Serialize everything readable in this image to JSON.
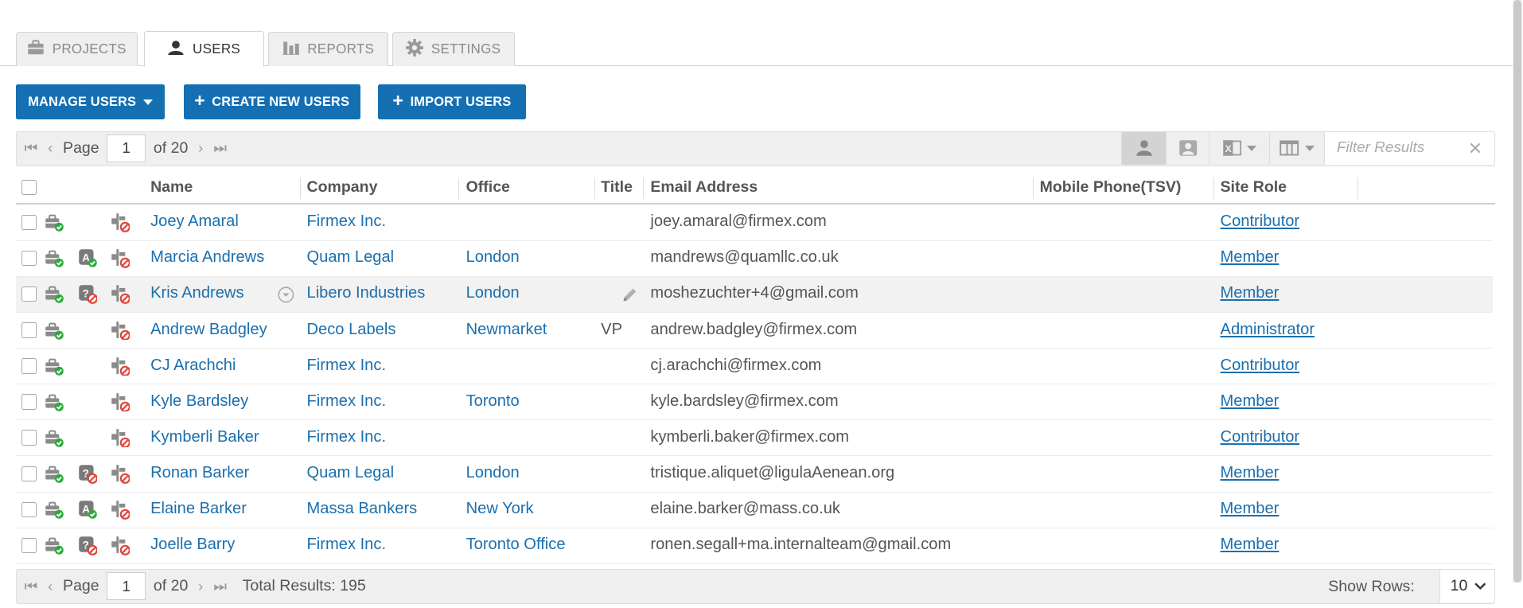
{
  "tabs": [
    {
      "label": "PROJECTS",
      "icon": "briefcase-icon"
    },
    {
      "label": "USERS",
      "icon": "user-icon",
      "active": true
    },
    {
      "label": "REPORTS",
      "icon": "bar-chart-icon"
    },
    {
      "label": "SETTINGS",
      "icon": "gear-icon"
    }
  ],
  "actions": {
    "manage_users": "MANAGE USERS",
    "create_new_users": "CREATE NEW USERS",
    "import_users": "IMPORT USERS"
  },
  "pager": {
    "page_label": "Page",
    "page_value": "1",
    "of_label": "of 20",
    "total_results": "Total Results: 195",
    "show_rows_label": "Show Rows:",
    "show_rows_value": "10"
  },
  "filter": {
    "placeholder": "Filter Results"
  },
  "columns": {
    "name": "Name",
    "company": "Company",
    "office": "Office",
    "title": "Title",
    "email": "Email Address",
    "mobile": "Mobile Phone(TSV)",
    "role": "Site Role"
  },
  "rows": [
    {
      "name": "Joey Amaral",
      "company": "Firmex Inc.",
      "office": "",
      "title": "",
      "email": "joey.amaral@firmex.com",
      "mobile": "",
      "role": "Contributor",
      "status_icon": ""
    },
    {
      "name": "Marcia Andrews",
      "company": "Quam Legal",
      "office": "London",
      "title": "",
      "email": "mandrews@quamllc.co.uk",
      "mobile": "",
      "role": "Member",
      "status_icon": "auth-approved-icon"
    },
    {
      "name": "Kris Andrews",
      "company": "Libero Industries",
      "office": "London",
      "title": "",
      "email": "moshezuchter+4@gmail.com",
      "mobile": "",
      "role": "Member",
      "status_icon": "auth-blocked-icon"
    },
    {
      "name": "Andrew Badgley",
      "company": "Deco Labels",
      "office": "Newmarket",
      "title": "VP",
      "email": "andrew.badgley@firmex.com",
      "mobile": "",
      "role": "Administrator",
      "status_icon": ""
    },
    {
      "name": "CJ Arachchi",
      "company": "Firmex Inc.",
      "office": "",
      "title": "",
      "email": "cj.arachchi@firmex.com",
      "mobile": "",
      "role": "Contributor",
      "status_icon": ""
    },
    {
      "name": "Kyle Bardsley",
      "company": "Firmex Inc.",
      "office": "Toronto",
      "title": "",
      "email": "kyle.bardsley@firmex.com",
      "mobile": "",
      "role": "Member",
      "status_icon": ""
    },
    {
      "name": "Kymberli Baker",
      "company": "Firmex Inc.",
      "office": "",
      "title": "",
      "email": "kymberli.baker@firmex.com",
      "mobile": "",
      "role": "Contributor",
      "status_icon": ""
    },
    {
      "name": "Ronan Barker",
      "company": "Quam Legal",
      "office": "London",
      "title": "",
      "email": "tristique.aliquet@ligulaAenean.org",
      "mobile": "",
      "role": "Member",
      "status_icon": "auth-blocked-icon"
    },
    {
      "name": "Elaine Barker",
      "company": "Massa Bankers",
      "office": "New York",
      "title": "",
      "email": "elaine.barker@mass.co.uk",
      "mobile": "",
      "role": "Member",
      "status_icon": "auth-approved-icon"
    },
    {
      "name": "Joelle Barry",
      "company": "Firmex Inc.",
      "office": "Toronto Office",
      "title": "",
      "email": "ronen.segall+ma.internalteam@gmail.com",
      "mobile": "",
      "role": "Member",
      "status_icon": "auth-blocked-icon"
    }
  ],
  "colors": {
    "accent": "#1470b3",
    "link": "#1a6fae",
    "success": "#2eaa3c",
    "danger": "#e0453a"
  }
}
